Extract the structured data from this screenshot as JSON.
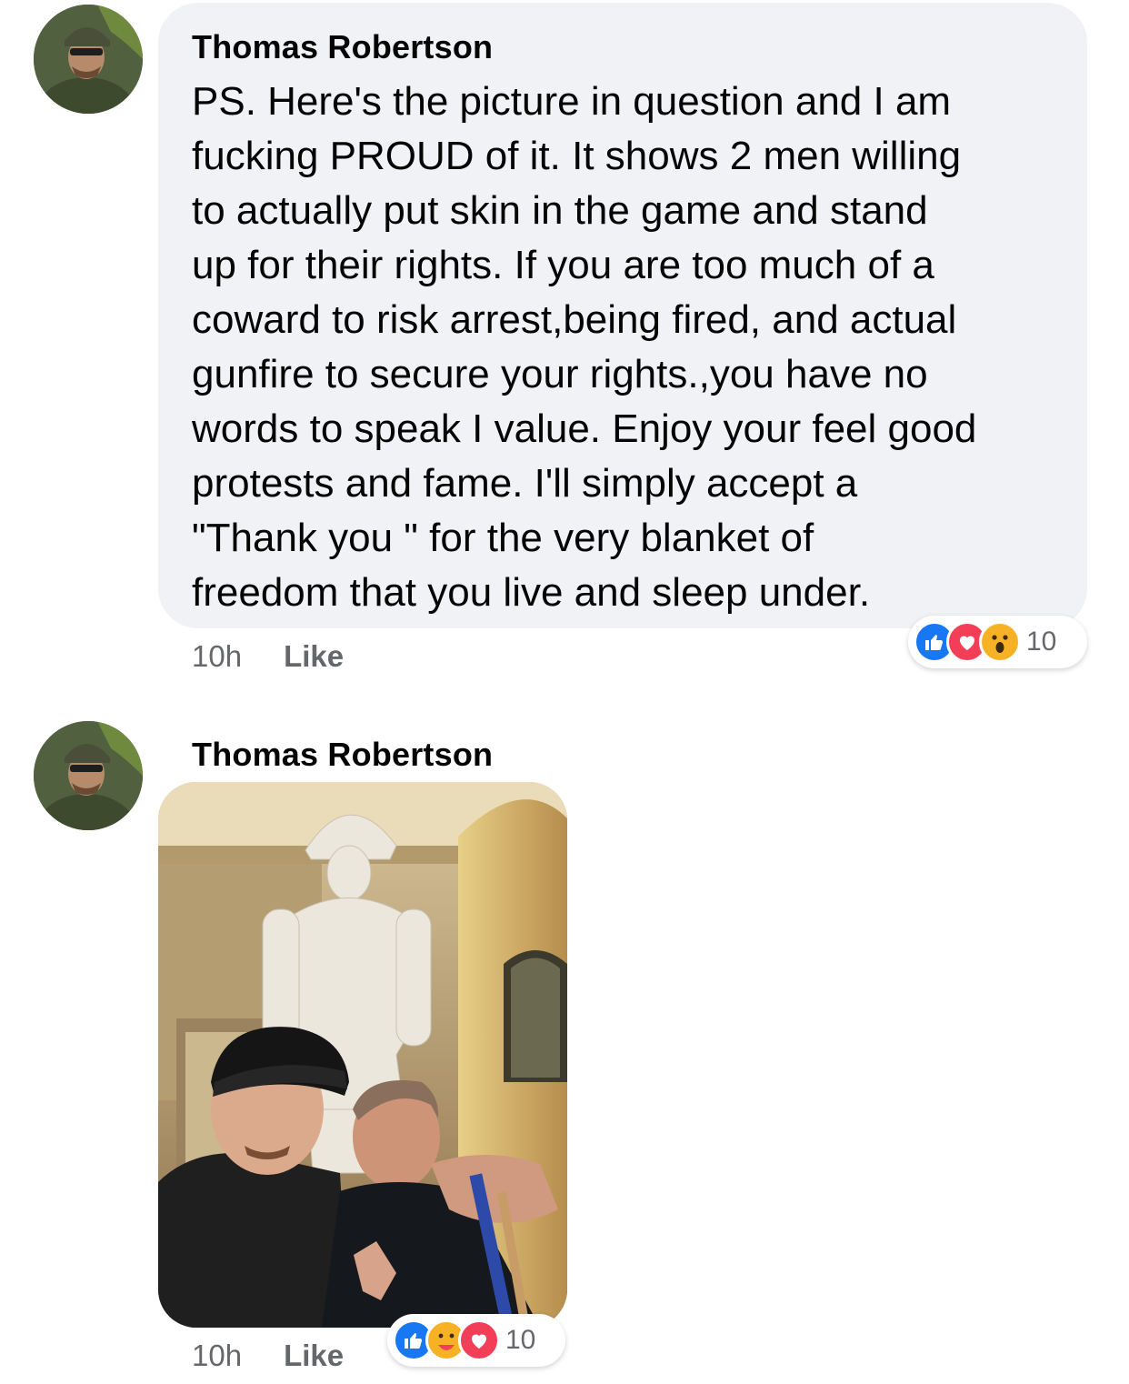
{
  "comments": [
    {
      "author": "Thomas Robertson",
      "text": "PS. Here's the picture in question and I am\nfucking PROUD of it. It shows 2 men willing\nto actually put skin in the game and stand\nup for their rights. If you are too much of a\ncoward to risk arrest,being fired, and actual\ngunfire to secure your rights.,you have no\nwords to speak I value. Enjoy your feel good\nprotests and fame. I'll simply accept a\n\"Thank you \" for the very blanket of\nfreedom that you live and sleep under.",
      "time": "10h",
      "like_label": "Like",
      "reactions": [
        "like-icon",
        "love-icon",
        "wow-icon"
      ],
      "reaction_count": "10"
    },
    {
      "author": "Thomas Robertson",
      "time": "10h",
      "like_label": "Like",
      "reactions": [
        "like-icon",
        "care-icon",
        "love-icon"
      ],
      "reaction_count": "10"
    }
  ],
  "colors": {
    "bubble": "#f0f2f5",
    "like_blue": "#1877f2",
    "love_red": "#f33e58",
    "wow_yellow": "#f7b125",
    "meta_gray": "#65676b"
  }
}
